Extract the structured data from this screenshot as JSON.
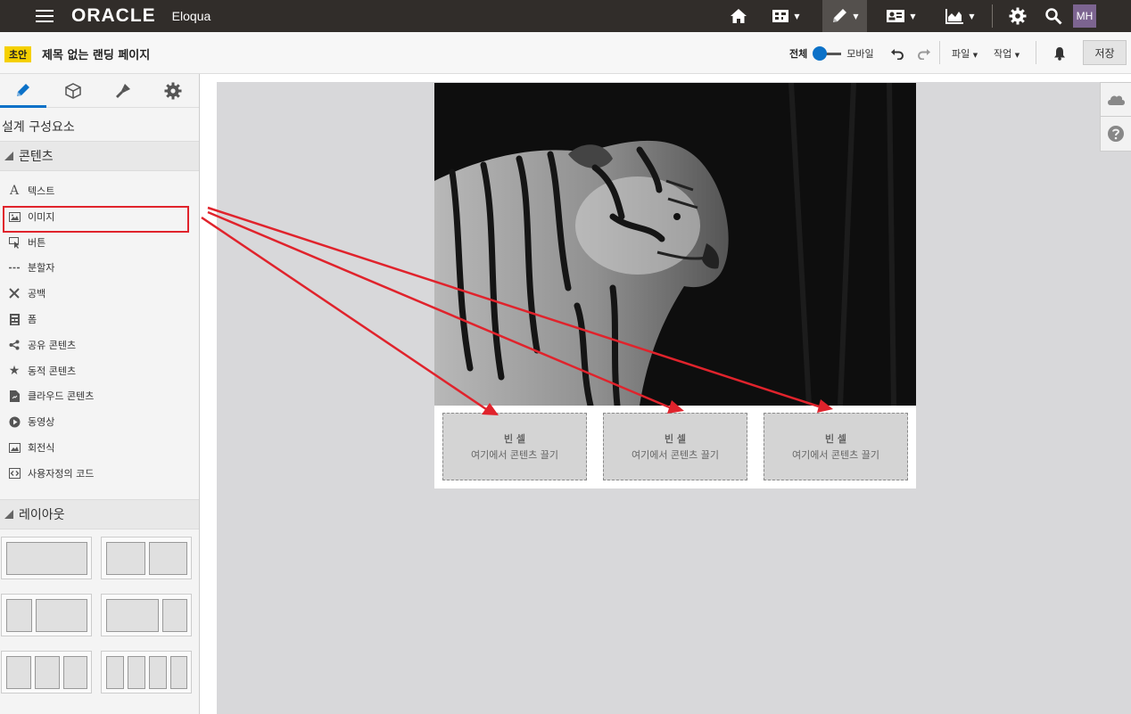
{
  "topbar": {
    "brand": "ORACLE",
    "product": "Eloqua",
    "user_initials": "MH",
    "icons": [
      "home-icon",
      "dashboard-icon",
      "edit-icon",
      "contacts-icon",
      "analytics-icon",
      "settings-icon",
      "search-icon"
    ]
  },
  "subbar": {
    "draft_label": "초안",
    "page_title": "제목 없는 랜딩 페이지",
    "view_all_label": "전체",
    "mobile_label": "모바일",
    "file_menu": "파일",
    "actions_menu": "작업",
    "save_label": "저장"
  },
  "left_panel": {
    "tabs": [
      "design-tab",
      "components-tab",
      "style-tab",
      "settings-tab"
    ],
    "heading": "설계 구성요소",
    "content_section": "콘텐츠",
    "items": [
      {
        "label": "텍스트",
        "icon": "text-icon"
      },
      {
        "label": "이미지",
        "icon": "image-icon"
      },
      {
        "label": "버튼",
        "icon": "button-icon"
      },
      {
        "label": "분할자",
        "icon": "divider-icon"
      },
      {
        "label": "공백",
        "icon": "spacer-icon"
      },
      {
        "label": "폼",
        "icon": "form-icon"
      },
      {
        "label": "공유 콘텐츠",
        "icon": "share-icon"
      },
      {
        "label": "동적 콘텐츠",
        "icon": "star-icon"
      },
      {
        "label": "클라우드 콘텐츠",
        "icon": "cloud-content-icon"
      },
      {
        "label": "동영상",
        "icon": "play-icon"
      },
      {
        "label": "회전식",
        "icon": "carousel-icon"
      },
      {
        "label": "사용자정의 코드",
        "icon": "code-icon"
      }
    ],
    "layout_section": "레이아웃"
  },
  "canvas": {
    "empty_cells": [
      {
        "title": "빈 셀",
        "hint": "여기에서 콘텐츠 끌기"
      },
      {
        "title": "빈 셀",
        "hint": "여기에서 콘텐츠 끌기"
      },
      {
        "title": "빈 셀",
        "hint": "여기에서 콘텐츠 끌기"
      }
    ]
  },
  "colors": {
    "topbar": "#312d2a",
    "accent": "#0b71c8",
    "annotation": "#e0232c",
    "avatar": "#7c6490",
    "draft_badge": "#f5d000"
  }
}
